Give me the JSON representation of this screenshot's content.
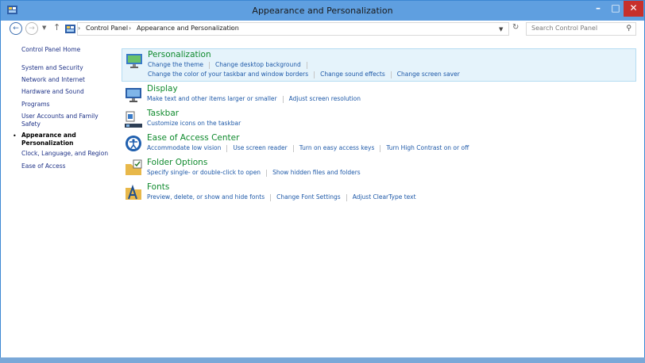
{
  "window": {
    "title": "Appearance and Personalization"
  },
  "titlebar_buttons": {
    "minimize": "–",
    "maximize": "□",
    "close": "✕"
  },
  "nav": {
    "back_icon": "back-arrow-icon",
    "forward_icon": "forward-arrow-icon",
    "up_icon": "up-arrow-icon",
    "breadcrumb": [
      "Control Panel",
      "Appearance and Personalization"
    ],
    "refresh_icon": "refresh-icon"
  },
  "search": {
    "placeholder": "Search Control Panel"
  },
  "sidebar": {
    "items": [
      {
        "label": "Control Panel Home",
        "current": false
      },
      {
        "label": "System and Security",
        "current": false
      },
      {
        "label": "Network and Internet",
        "current": false
      },
      {
        "label": "Hardware and Sound",
        "current": false
      },
      {
        "label": "Programs",
        "current": false
      },
      {
        "label": "User Accounts and Family Safety",
        "current": false
      },
      {
        "label": "Appearance and Personalization",
        "current": true
      },
      {
        "label": "Clock, Language, and Region",
        "current": false
      },
      {
        "label": "Ease of Access",
        "current": false
      }
    ]
  },
  "categories": [
    {
      "title": "Personalization",
      "icon": "personalization-icon",
      "lines": [
        [
          "Change the theme",
          "Change desktop background"
        ],
        [
          "Change the color of your taskbar and window borders",
          "Change sound effects",
          "Change screen saver"
        ]
      ]
    },
    {
      "title": "Display",
      "icon": "display-icon",
      "lines": [
        [
          "Make text and other items larger or smaller",
          "Adjust screen resolution"
        ]
      ]
    },
    {
      "title": "Taskbar",
      "icon": "taskbar-icon",
      "lines": [
        [
          "Customize icons on the taskbar"
        ]
      ]
    },
    {
      "title": "Ease of Access Center",
      "icon": "ease-of-access-icon",
      "lines": [
        [
          "Accommodate low vision",
          "Use screen reader",
          "Turn on easy access keys",
          "Turn High Contrast on or off"
        ]
      ]
    },
    {
      "title": "Folder Options",
      "icon": "folder-options-icon",
      "lines": [
        [
          "Specify single- or double-click to open",
          "Show hidden files and folders"
        ]
      ]
    },
    {
      "title": "Fonts",
      "icon": "fonts-icon",
      "lines": [
        [
          "Preview, delete, or show and hide fonts",
          "Change Font Settings",
          "Adjust ClearType text"
        ]
      ]
    }
  ]
}
